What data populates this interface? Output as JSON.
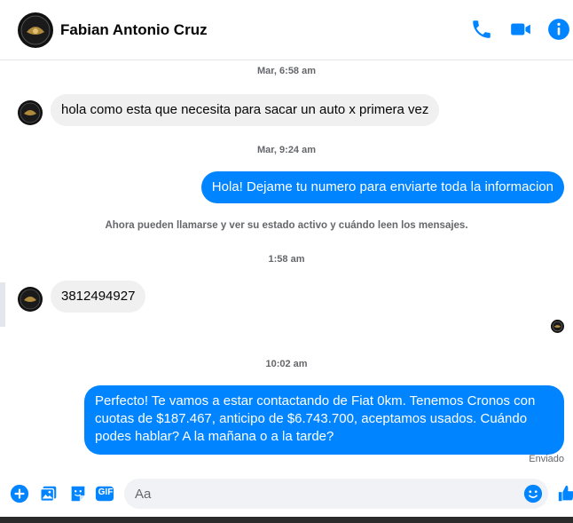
{
  "header": {
    "title": "Fabian Antonio Cruz",
    "icons": [
      "phone-icon",
      "video-icon",
      "info-icon"
    ]
  },
  "thread": {
    "timestamps": [
      "Mar, 6:58 am",
      "Mar, 9:24 am",
      "1:58 am",
      "10:02 am"
    ],
    "messages": [
      {
        "from": "contact",
        "text": "hola como esta  que necesita para sacar un auto x primera vez"
      },
      {
        "from": "me",
        "text": "Hola! Dejame tu numero para enviarte toda la informacion"
      },
      {
        "from": "contact",
        "text": "3812494927"
      },
      {
        "from": "me",
        "text": "Perfecto! Te vamos a estar contactando de Fiat 0km. Tenemos Cronos con cuotas de $187.467, anticipo de $6.743.700, aceptamos usados. Cuándo podes hablar? A la mañana o a la tarde?"
      }
    ],
    "system_notice": "Ahora pueden llamarse y ver su estado activo y cuándo leen los mensajes.",
    "delivery_status": "Enviado"
  },
  "composer": {
    "placeholder": "Aa",
    "gif_label": "GIF",
    "icons": [
      "add-icon",
      "photo-icon",
      "sticker-icon",
      "gif-icon",
      "emoji-icon",
      "like-icon"
    ]
  },
  "colors": {
    "accent": "#0084ff",
    "incoming_bubble": "#f0f0f0",
    "icon_blue": "#0084ff"
  }
}
